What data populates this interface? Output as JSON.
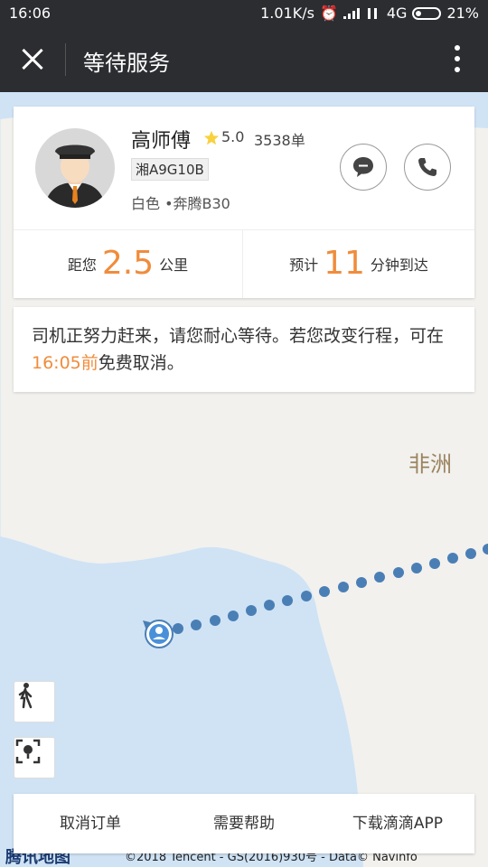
{
  "status_bar": {
    "time": "16:06",
    "speed": "1.01K/s",
    "network": "4G",
    "battery": "21%"
  },
  "header": {
    "title": "等待服务"
  },
  "driver": {
    "name": "高师傅",
    "rating": "5.0",
    "orders": "3538单",
    "plate": "湘A9G10B",
    "car": "白色 •奔腾B30"
  },
  "distance": {
    "prefix": "距您",
    "value": "2.5",
    "unit": "公里"
  },
  "eta": {
    "prefix": "预计",
    "value": "11",
    "unit": "分钟到达"
  },
  "notice": {
    "part1": "司机正努力赶来，请您耐心等待。若您改变行程，可在",
    "time": "16:05前",
    "part2": "免费取消。"
  },
  "map": {
    "label": "非洲",
    "brand": "腾讯地图",
    "copyright": "©2018 Tencent - GS(2016)930号 - Data© Navinfo"
  },
  "actions": {
    "cancel": "取消订单",
    "help": "需要帮助",
    "download": "下载滴滴APP"
  },
  "colors": {
    "accent": "#f08c3c",
    "route": "#4a7fb5",
    "header": "#2b2d31"
  }
}
